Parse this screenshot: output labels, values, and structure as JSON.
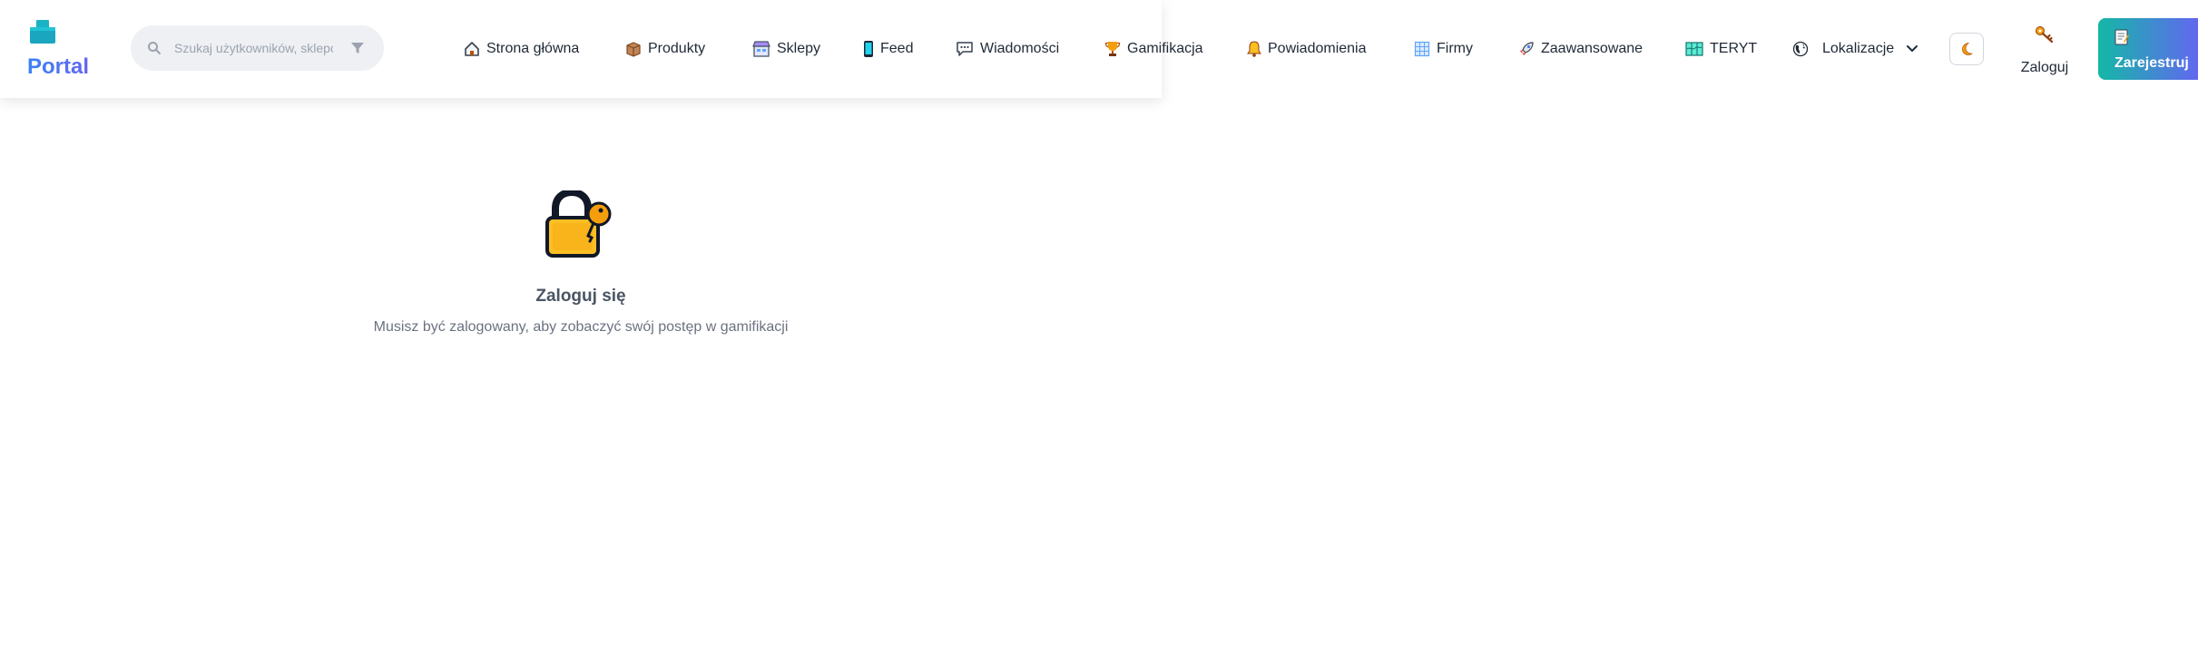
{
  "header": {
    "logo_text": "Portal",
    "search": {
      "placeholder": "Szukaj użytkowników, sklepów...",
      "value": ""
    },
    "nav": [
      {
        "label": "Strona główna",
        "icon": "house-icon"
      },
      {
        "label": "Produkty",
        "icon": "package-icon"
      },
      {
        "label": "Sklepy",
        "icon": "shop-icon"
      },
      {
        "label": "Feed",
        "icon": "phone-icon"
      },
      {
        "label": "Wiadomości",
        "icon": "speech-bubble-icon"
      },
      {
        "label": "Gamifikacja",
        "icon": "trophy-icon"
      },
      {
        "label": "Powiadomienia",
        "icon": "bell-icon"
      },
      {
        "label": "Firmy",
        "icon": "office-icon"
      },
      {
        "label": "Zaawansowane",
        "icon": "rocket-icon"
      },
      {
        "label": "TERYT",
        "icon": "map-icon"
      },
      {
        "label": "Lokalizacje",
        "icon": "globe-icon"
      }
    ],
    "theme_toggle_icon": "moon-icon",
    "login_label": "Zaloguj",
    "register_label": "Zarejestruj"
  },
  "empty_state": {
    "icon": "lock-with-key-icon",
    "title": "Zaloguj się",
    "description": "Musisz być zalogowany, aby zobaczyć swój postęp w gamifikacji"
  },
  "colors": {
    "brand_gradient_start": "#14b8a6",
    "brand_gradient_end": "#6366f1",
    "logo_teal": "#1ab3c6"
  }
}
